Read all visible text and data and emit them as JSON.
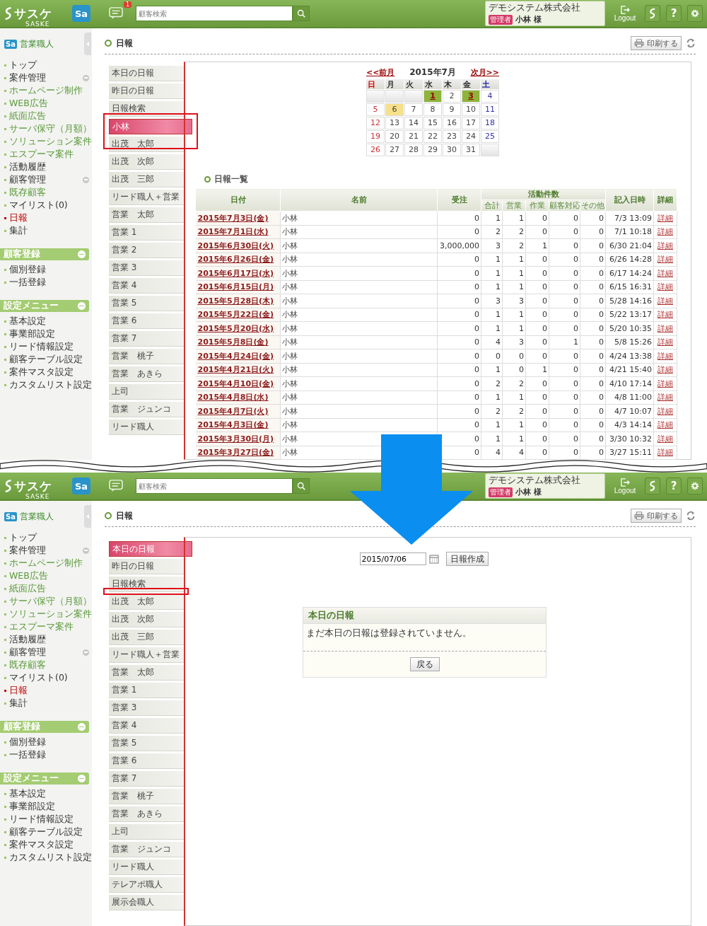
{
  "screens": [
    {
      "kind": "list",
      "header": {
        "logo": "サスケ",
        "logo_sub": "SASKE",
        "app_button": "Sa",
        "notifications": "1",
        "search_placeholder": "顧客検索",
        "company": "デモシステム株式会社",
        "role": "管理者",
        "user": "小林 様",
        "logout": "Logout",
        "help": "?"
      },
      "sidebar": {
        "app_icon": "Sa",
        "brand": "営業職人",
        "items": [
          {
            "label": "トップ",
            "selected": false
          },
          {
            "label": "案件管理",
            "selected": false,
            "expanded": true,
            "children": [
              {
                "label": "ホームページ制作",
                "selected": false
              },
              {
                "label": "WEB広告",
                "selected": false
              },
              {
                "label": "紙面広告",
                "selected": false
              },
              {
                "label": "サーバ保守（月額）",
                "selected": false
              },
              {
                "label": "ソリューション案件",
                "selected": false
              },
              {
                "label": "エスプーマ案件",
                "selected": false
              }
            ]
          },
          {
            "label": "活動履歴",
            "selected": false
          },
          {
            "label": "顧客管理",
            "selected": false,
            "expanded": true,
            "children": [
              {
                "label": "既存顧客",
                "selected": false
              }
            ]
          },
          {
            "label": "マイリスト(0)",
            "selected": false
          },
          {
            "label": "日報",
            "selected": true
          },
          {
            "label": "集計",
            "selected": false
          }
        ],
        "sections": [
          {
            "title": "顧客登録",
            "expanded": true,
            "items": [
              {
                "label": "個別登録",
                "selected": false
              },
              {
                "label": "一括登録",
                "selected": false
              }
            ]
          },
          {
            "title": "設定メニュー",
            "expanded": true,
            "items": [
              {
                "label": "基本設定",
                "selected": false
              },
              {
                "label": "事業部設定",
                "selected": false
              },
              {
                "label": "リード情報設定",
                "selected": false
              },
              {
                "label": "顧客テーブル設定",
                "selected": false
              },
              {
                "label": "案件マスタ設定",
                "selected": false
              },
              {
                "label": "カスタムリスト設定",
                "selected": false
              }
            ]
          }
        ]
      },
      "page_title": "日報",
      "print_button": "印刷する",
      "user_list": [
        {
          "label": "本日の日報",
          "selected": false
        },
        {
          "label": "昨日の日報",
          "selected": false
        },
        {
          "label": "日報検索",
          "selected": false
        },
        {
          "label": "小林",
          "selected": true
        },
        {
          "label": "出茂　太郎",
          "selected": false
        },
        {
          "label": "出茂　次郎",
          "selected": false
        },
        {
          "label": "出茂　三郎",
          "selected": false
        },
        {
          "label": "リード職人＋営業",
          "selected": false
        },
        {
          "label": "営業　太郎",
          "selected": false
        },
        {
          "label": "営業 1",
          "selected": false
        },
        {
          "label": "営業 2",
          "selected": false
        },
        {
          "label": "営業 3",
          "selected": false
        },
        {
          "label": "営業 4",
          "selected": false
        },
        {
          "label": "営業 5",
          "selected": false
        },
        {
          "label": "営業 6",
          "selected": false
        },
        {
          "label": "営業 7",
          "selected": false
        },
        {
          "label": "営業　桃子",
          "selected": false
        },
        {
          "label": "営業　あきら",
          "selected": false
        },
        {
          "label": "上司",
          "selected": false
        },
        {
          "label": "営業　ジュンコ",
          "selected": false
        },
        {
          "label": "リード職人",
          "selected": false
        }
      ],
      "calendar": {
        "prev": "<<前月",
        "month": "2015年7月",
        "next": "次月>>",
        "weekdays": [
          "日",
          "月",
          "火",
          "水",
          "木",
          "金",
          "土"
        ],
        "weeks": [
          [
            {
              "kind": "blank"
            },
            {
              "kind": "blank"
            },
            {
              "kind": "blank"
            },
            {
              "day": "1",
              "has_report": true,
              "today": false
            },
            {
              "day": "2",
              "has_report": false,
              "today": false
            },
            {
              "day": "3",
              "has_report": true,
              "today": false
            },
            {
              "day": "4",
              "has_report": false,
              "today": false
            }
          ],
          [
            {
              "day": "5",
              "has_report": false,
              "today": false
            },
            {
              "day": "6",
              "has_report": false,
              "today": true
            },
            {
              "day": "7",
              "has_report": false,
              "today": false
            },
            {
              "day": "8",
              "has_report": false,
              "today": false
            },
            {
              "day": "9",
              "has_report": false,
              "today": false
            },
            {
              "day": "10",
              "has_report": false,
              "today": false
            },
            {
              "day": "11",
              "has_report": false,
              "today": false
            }
          ],
          [
            {
              "day": "12",
              "has_report": false,
              "today": false
            },
            {
              "day": "13",
              "has_report": false,
              "today": false
            },
            {
              "day": "14",
              "has_report": false,
              "today": false
            },
            {
              "day": "15",
              "has_report": false,
              "today": false
            },
            {
              "day": "16",
              "has_report": false,
              "today": false
            },
            {
              "day": "17",
              "has_report": false,
              "today": false
            },
            {
              "day": "18",
              "has_report": false,
              "today": false
            }
          ],
          [
            {
              "day": "19",
              "has_report": false,
              "today": false
            },
            {
              "day": "20",
              "has_report": false,
              "today": false
            },
            {
              "day": "21",
              "has_report": false,
              "today": false
            },
            {
              "day": "22",
              "has_report": false,
              "today": false
            },
            {
              "day": "23",
              "has_report": false,
              "today": false
            },
            {
              "day": "24",
              "has_report": false,
              "today": false
            },
            {
              "day": "25",
              "has_report": false,
              "today": false
            }
          ],
          [
            {
              "day": "26",
              "has_report": false,
              "today": false
            },
            {
              "day": "27",
              "has_report": false,
              "today": false
            },
            {
              "day": "28",
              "has_report": false,
              "today": false
            },
            {
              "day": "29",
              "has_report": false,
              "today": false
            },
            {
              "day": "30",
              "has_report": false,
              "today": false
            },
            {
              "day": "31",
              "has_report": false,
              "today": false
            },
            {
              "kind": "blank"
            }
          ]
        ]
      },
      "list_title": "日報一覧",
      "table": {
        "columns": [
          {
            "label": "日付"
          },
          {
            "label": "名前"
          },
          {
            "label": "受注"
          },
          {
            "label": "活動件数",
            "colspan": 5,
            "children": [
              "合計",
              "営業",
              "作業",
              "顧客対応",
              "その他"
            ]
          },
          {
            "label": "記入日時"
          },
          {
            "label": "詳細"
          }
        ],
        "rows": [
          [
            "2015年7月3日(金)",
            "小林",
            "0",
            "1",
            "1",
            "0",
            "0",
            "0",
            "7/3 13:09",
            "詳細"
          ],
          [
            "2015年7月1日(水)",
            "小林",
            "0",
            "2",
            "2",
            "0",
            "0",
            "0",
            "7/1 10:18",
            "詳細"
          ],
          [
            "2015年6月30日(火)",
            "小林",
            "3,000,000",
            "3",
            "2",
            "1",
            "0",
            "0",
            "6/30 21:04",
            "詳細"
          ],
          [
            "2015年6月26日(金)",
            "小林",
            "0",
            "1",
            "1",
            "0",
            "0",
            "0",
            "6/26 14:28",
            "詳細"
          ],
          [
            "2015年6月17日(水)",
            "小林",
            "0",
            "1",
            "1",
            "0",
            "0",
            "0",
            "6/17 14:24",
            "詳細"
          ],
          [
            "2015年6月15日(月)",
            "小林",
            "0",
            "1",
            "1",
            "0",
            "0",
            "0",
            "6/15 16:31",
            "詳細"
          ],
          [
            "2015年5月28日(木)",
            "小林",
            "0",
            "3",
            "3",
            "0",
            "0",
            "0",
            "5/28 14:16",
            "詳細"
          ],
          [
            "2015年5月22日(金)",
            "小林",
            "0",
            "1",
            "1",
            "0",
            "0",
            "0",
            "5/22 13:17",
            "詳細"
          ],
          [
            "2015年5月20日(水)",
            "小林",
            "0",
            "1",
            "1",
            "0",
            "0",
            "0",
            "5/20 10:35",
            "詳細"
          ],
          [
            "2015年5月8日(金)",
            "小林",
            "0",
            "4",
            "3",
            "0",
            "1",
            "0",
            "5/8 15:26",
            "詳細"
          ],
          [
            "2015年4月24日(金)",
            "小林",
            "0",
            "0",
            "0",
            "0",
            "0",
            "0",
            "4/24 13:38",
            "詳細"
          ],
          [
            "2015年4月21日(火)",
            "小林",
            "0",
            "1",
            "0",
            "1",
            "0",
            "0",
            "4/21 15:40",
            "詳細"
          ],
          [
            "2015年4月10日(金)",
            "小林",
            "0",
            "2",
            "2",
            "0",
            "0",
            "0",
            "4/10 17:14",
            "詳細"
          ],
          [
            "2015年4月8日(水)",
            "小林",
            "0",
            "1",
            "1",
            "0",
            "0",
            "0",
            "4/8 11:00",
            "詳細"
          ],
          [
            "2015年4月7日(火)",
            "小林",
            "0",
            "2",
            "2",
            "0",
            "0",
            "0",
            "4/7 10:07",
            "詳細"
          ],
          [
            "2015年4月3日(金)",
            "小林",
            "0",
            "1",
            "1",
            "0",
            "0",
            "0",
            "4/3 14:14",
            "詳細"
          ],
          [
            "2015年3月30日(月)",
            "小林",
            "0",
            "1",
            "1",
            "0",
            "0",
            "0",
            "3/30 10:32",
            "詳細"
          ],
          [
            "2015年3月27日(金)",
            "小林",
            "0",
            "4",
            "4",
            "0",
            "0",
            "0",
            "3/27 15:11",
            "詳細"
          ]
        ]
      }
    },
    {
      "kind": "form",
      "header": {
        "logo": "サスケ",
        "logo_sub": "SASKE",
        "app_button": "Sa",
        "search_placeholder": "顧客検索",
        "company": "デモシステム株式会社",
        "role": "管理者",
        "user": "小林 様",
        "logout": "Logout",
        "help": "?"
      },
      "sidebar": {
        "app_icon": "Sa",
        "brand": "営業職人",
        "items": [
          {
            "label": "トップ",
            "selected": false
          },
          {
            "label": "案件管理",
            "selected": false,
            "expanded": true,
            "children": [
              {
                "label": "ホームページ制作",
                "selected": false
              },
              {
                "label": "WEB広告",
                "selected": false
              },
              {
                "label": "紙面広告",
                "selected": false
              },
              {
                "label": "サーバ保守（月額）",
                "selected": false
              },
              {
                "label": "ソリューション案件",
                "selected": false
              },
              {
                "label": "エスプーマ案件",
                "selected": false
              }
            ]
          },
          {
            "label": "活動履歴",
            "selected": false
          },
          {
            "label": "顧客管理",
            "selected": false,
            "expanded": true,
            "children": [
              {
                "label": "既存顧客",
                "selected": false
              }
            ]
          },
          {
            "label": "マイリスト(0)",
            "selected": false
          },
          {
            "label": "日報",
            "selected": true
          },
          {
            "label": "集計",
            "selected": false
          }
        ],
        "sections": [
          {
            "title": "顧客登録",
            "expanded": true,
            "items": [
              {
                "label": "個別登録",
                "selected": false
              },
              {
                "label": "一括登録",
                "selected": false
              }
            ]
          },
          {
            "title": "設定メニュー",
            "expanded": true,
            "items": [
              {
                "label": "基本設定",
                "selected": false
              },
              {
                "label": "事業部設定",
                "selected": false
              },
              {
                "label": "リード情報設定",
                "selected": false
              },
              {
                "label": "顧客テーブル設定",
                "selected": false
              },
              {
                "label": "案件マスタ設定",
                "selected": false
              },
              {
                "label": "カスタムリスト設定",
                "selected": false
              }
            ]
          }
        ]
      },
      "page_title": "日報",
      "print_button": "印刷する",
      "user_list": [
        {
          "label": "本日の日報",
          "selected": true
        },
        {
          "label": "昨日の日報",
          "selected": false
        },
        {
          "label": "日報検索",
          "selected": false
        },
        {
          "label": "出茂　太郎",
          "selected": false
        },
        {
          "label": "出茂　次郎",
          "selected": false
        },
        {
          "label": "出茂　三郎",
          "selected": false
        },
        {
          "label": "リード職人＋営業",
          "selected": false
        },
        {
          "label": "営業　太郎",
          "selected": false
        },
        {
          "label": "営業 1",
          "selected": false
        },
        {
          "label": "営業 3",
          "selected": false
        },
        {
          "label": "営業 4",
          "selected": false
        },
        {
          "label": "営業 5",
          "selected": false
        },
        {
          "label": "営業 6",
          "selected": false
        },
        {
          "label": "営業 7",
          "selected": false
        },
        {
          "label": "営業　桃子",
          "selected": false
        },
        {
          "label": "営業　あきら",
          "selected": false
        },
        {
          "label": "上司",
          "selected": false
        },
        {
          "label": "営業　ジュンコ",
          "selected": false
        },
        {
          "label": "リード職人",
          "selected": false
        },
        {
          "label": "テレアポ職人",
          "selected": false
        },
        {
          "label": "展示会職人",
          "selected": false
        }
      ],
      "date_value": "2015/07/06",
      "create_button": "日報作成",
      "panel": {
        "title": "本日の日報",
        "message": "まだ本日の日報は登録されていません。",
        "back_button": "戻る"
      }
    }
  ]
}
